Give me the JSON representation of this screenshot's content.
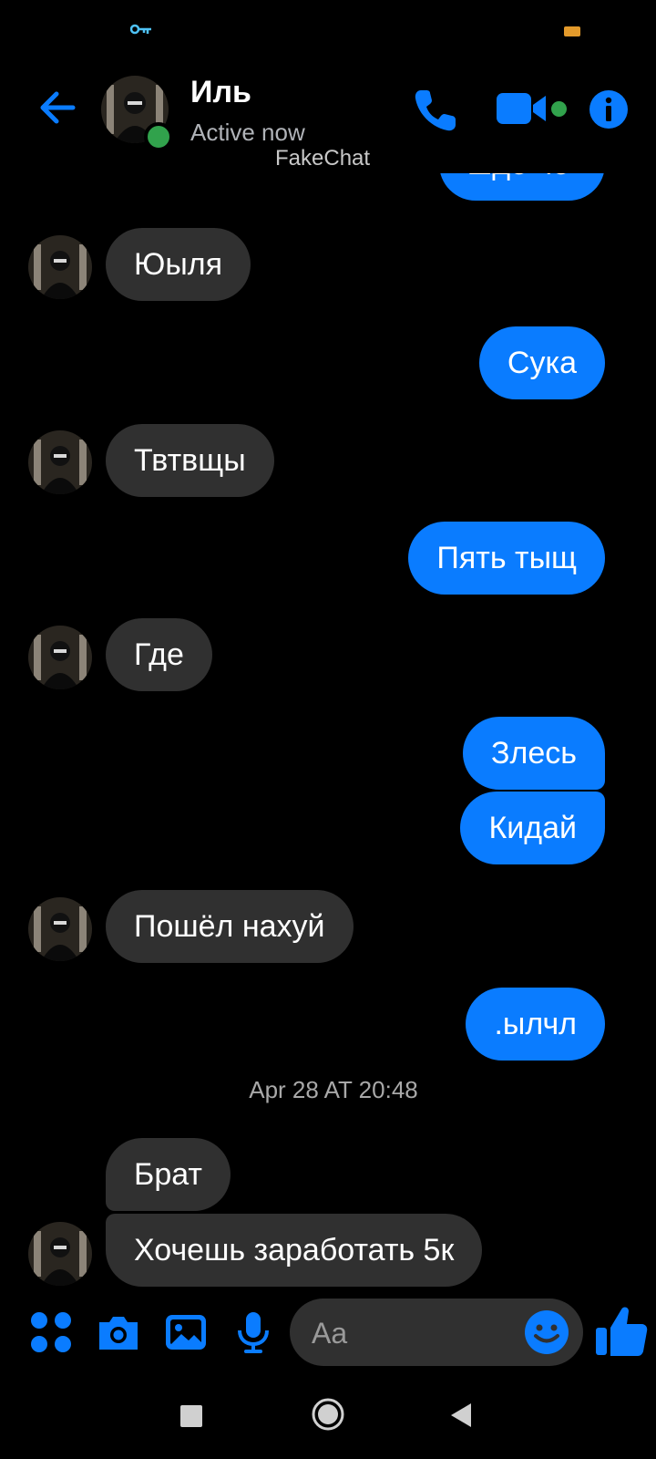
{
  "status_bar": {
    "key_icon": "key-icon",
    "battery_color": "#e39a2b"
  },
  "header": {
    "contact_name": "Иль",
    "status": "Active now",
    "watermark": "FakeChat",
    "icons": {
      "back": "arrow-left-icon",
      "call": "phone-icon",
      "video": "video-camera-icon",
      "info": "info-icon"
    },
    "accent_color": "#0a7cff",
    "online_color": "#31a24c"
  },
  "messages": [
    {
      "from": "me",
      "text": "шде че"
    },
    {
      "from": "them",
      "text": "Юыля"
    },
    {
      "from": "me",
      "text": "Сука"
    },
    {
      "from": "them",
      "text": "Твтвщы"
    },
    {
      "from": "me",
      "text": "Пять тыщ"
    },
    {
      "from": "them",
      "text": "Где"
    },
    {
      "from": "me",
      "text": "Злесь"
    },
    {
      "from": "me",
      "text": "Кидай"
    },
    {
      "from": "them",
      "text": "Пошёл нахуй"
    },
    {
      "from": "me",
      "text": ".ылчл"
    },
    {
      "from": "them",
      "text": "Брат"
    },
    {
      "from": "them",
      "text": "Хочешь заработать 5к"
    }
  ],
  "timestamp": "Apr 28 AT 20:48",
  "composer": {
    "placeholder": "Aa",
    "icons": [
      "apps-grid-icon",
      "camera-icon",
      "image-icon",
      "microphone-icon",
      "emoji-icon",
      "thumbs-up-icon"
    ]
  },
  "nav_bar": {
    "icons": [
      "recent-apps-icon",
      "home-icon",
      "back-icon"
    ]
  }
}
